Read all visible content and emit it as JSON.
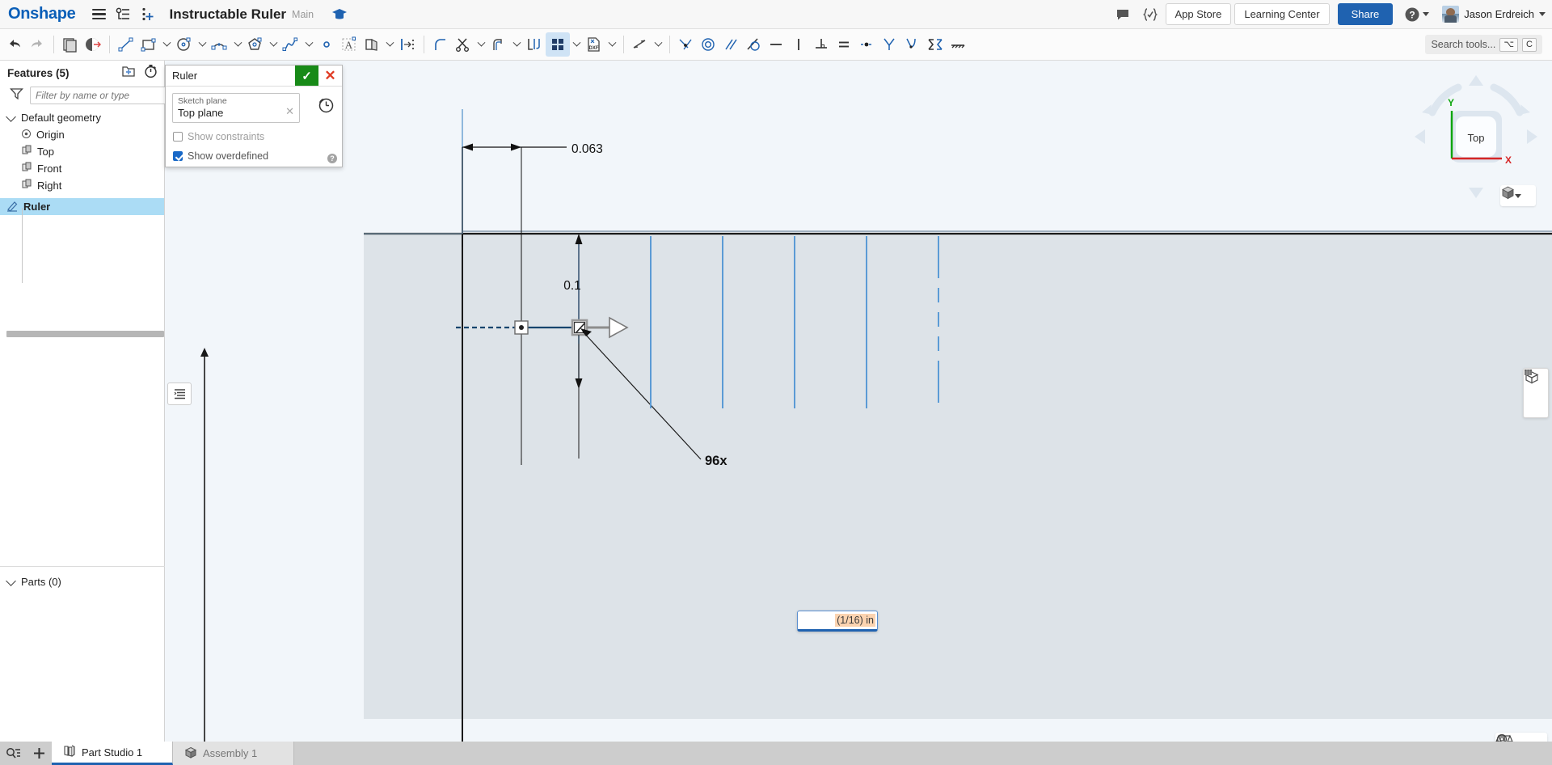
{
  "header": {
    "logo": "Onshape",
    "menu_icon": "hamburger-icon",
    "versions_icon": "version-graph-icon",
    "insert_icon": "add-feature-icon",
    "document_title": "Instructable Ruler",
    "workspace": "Main",
    "grad_icon": "graduation-cap-icon",
    "comment_icon": "comment-icon",
    "featurescript_icon": "featurescript-icon",
    "app_store_label": "App Store",
    "learning_center_label": "Learning Center",
    "share_label": "Share",
    "help_icon": "question-mark-icon",
    "user_name": "Jason Erdreich"
  },
  "toolbar": {
    "undo": "undo-icon",
    "redo": "redo-icon",
    "sketch": "new-sketch-icon",
    "plane": "plane-icon",
    "line": "line-icon",
    "rectangle": "rectangle-icon",
    "circle": "circle-icon",
    "arc": "arc-icon",
    "polygon": "polygon-icon",
    "spline": "spline-icon",
    "point": "point-icon",
    "text": "sketch-text-icon",
    "mirror": "mirror-icon",
    "linear_pattern": "linear-pattern-icon",
    "fillet": "sketch-fillet-icon",
    "trim": "trim-icon",
    "offset": "offset-icon",
    "use_project": "use-project-icon",
    "grid": "grid-icon",
    "dxf": "import-dxf-icon",
    "dimension": "dimension-icon",
    "coincident": "coincident-icon",
    "concentric": "concentric-icon",
    "parallel": "parallel-icon",
    "tangent": "tangent-icon",
    "horizontal": "horizontal-icon",
    "vertical": "vertical-icon",
    "perpendicular": "perpendicular-icon",
    "equal": "equal-icon",
    "midpoint": "midpoint-icon",
    "symmetric": "symmetric-icon",
    "curvature": "curvature-icon",
    "construction": "construction-icon",
    "fix": "fix-icon",
    "search_placeholder": "Search tools...",
    "search_key_alt": "⌥",
    "search_key_c": "C"
  },
  "features_panel": {
    "title": "Features (5)",
    "folder_icon": "new-folder-icon",
    "history_icon": "history-timer-icon",
    "filter_icon": "filter-funnel-icon",
    "filter_placeholder": "Filter by name or type",
    "default_geometry": "Default geometry",
    "items": [
      {
        "label": "Origin",
        "icon": "origin-icon"
      },
      {
        "label": "Top",
        "icon": "plane-icon"
      },
      {
        "label": "Front",
        "icon": "plane-icon"
      },
      {
        "label": "Right",
        "icon": "plane-icon"
      }
    ],
    "active_feature": {
      "label": "Ruler",
      "icon": "sketch-pencil-icon"
    },
    "parts_title": "Parts (0)",
    "list_button_icon": "feature-list-icon"
  },
  "sketch_dialog": {
    "name": "Ruler",
    "ok_icon": "checkmark-icon",
    "cancel_icon": "close-x-icon",
    "history_icon": "sketch-history-icon",
    "plane_label": "Sketch plane",
    "plane_value": "Top plane",
    "clear_icon": "clear-x-icon",
    "show_constraints_label": "Show constraints",
    "show_constraints_checked": false,
    "show_overdefined_label": "Show overdefined",
    "show_overdefined_checked": true,
    "help_icon": "help-icon"
  },
  "canvas": {
    "dimension_top": "0.063",
    "dimension_vertical": "0.1",
    "pattern_count": "96x",
    "dim_input_value": "(1/16) in",
    "view_cube": {
      "face_label": "Top",
      "axis_x": "X",
      "axis_y": "Y",
      "display_icon": "display-style-cube-icon"
    },
    "right_tools": [
      {
        "icon": "section-view-icon"
      },
      {
        "icon": "render-view-icon"
      }
    ],
    "bottom_tools": [
      {
        "icon": "measure-tape-icon"
      },
      {
        "icon": "mass-properties-scale-icon"
      }
    ]
  },
  "colors": {
    "brand_blue": "#0b5fb8",
    "accent_blue": "#1f62b0",
    "selection_blue": "#abdcf5",
    "ok_green": "#188a18",
    "cancel_red": "#e03b24",
    "sketch_blue": "#5b9bd5",
    "canvas_bg": "#f2f6fa",
    "plane_fill": "#dde3e8",
    "dim_selection": "#fbd3b0",
    "axis_x_red": "#d62626",
    "axis_y_green": "#0fa60f"
  },
  "tabs": {
    "search_icon": "tab-search-icon",
    "add_icon": "add-tab-icon",
    "items": [
      {
        "label": "Part Studio 1",
        "icon": "part-studio-icon",
        "active": true
      },
      {
        "label": "Assembly 1",
        "icon": "assembly-icon",
        "active": false
      }
    ]
  }
}
